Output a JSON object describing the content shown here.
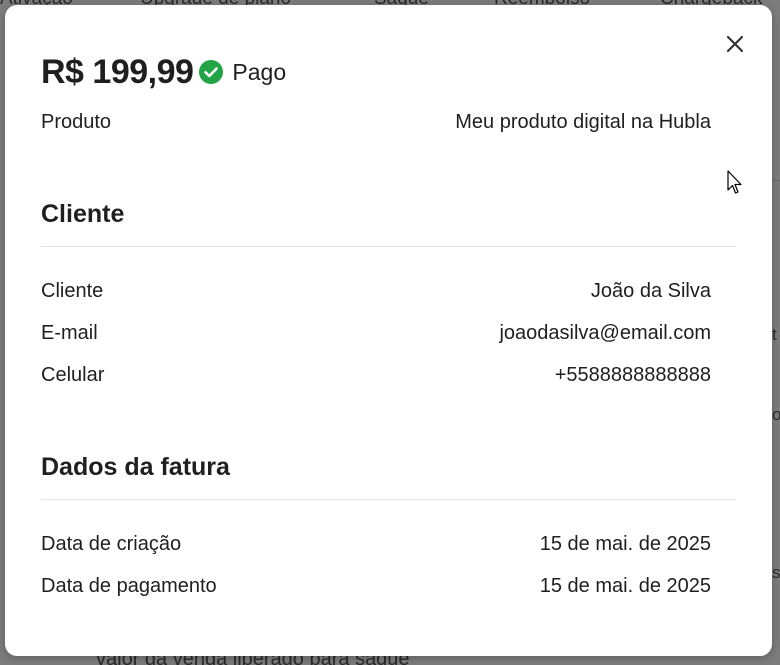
{
  "modal": {
    "amount": "R$ 199,99",
    "status": {
      "label": "Pago",
      "icon": "check-circle-icon",
      "color": "#22a447"
    },
    "product": {
      "label": "Produto",
      "value": "Meu produto digital na Hubla"
    },
    "customer_section": {
      "title": "Cliente",
      "rows": [
        {
          "label": "Cliente",
          "value": "João da Silva"
        },
        {
          "label": "E-mail",
          "value": "joaodasilva@email.com"
        },
        {
          "label": "Celular",
          "value": "+5588888888888"
        }
      ]
    },
    "invoice_section": {
      "title": "Dados da fatura",
      "rows": [
        {
          "label": "Data de criação",
          "value": "15 de mai. de 2025"
        },
        {
          "label": "Data de pagamento",
          "value": "15 de mai. de 2025"
        }
      ]
    }
  },
  "background": {
    "tabs": [
      "Ativação",
      "Upgrade de plano",
      "Saque",
      "Reembolso",
      "Chargeback"
    ],
    "bottom_text": "valor da venda liberado para saque",
    "right_edge_chars": [
      "t",
      "o",
      "s"
    ]
  }
}
